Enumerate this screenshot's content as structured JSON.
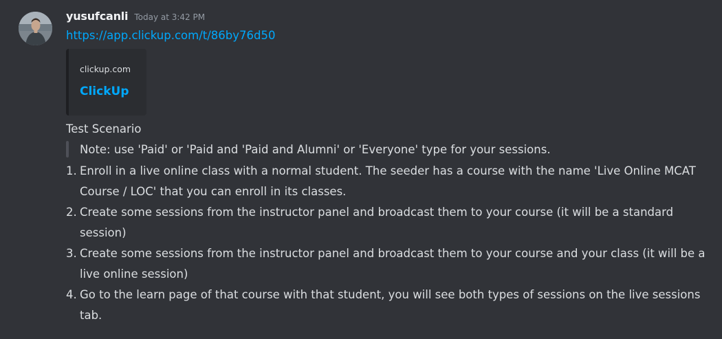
{
  "message": {
    "username": "yusufcanli",
    "timestamp": "Today at 3:42 PM",
    "link": "https://app.clickup.com/t/86by76d50",
    "embed": {
      "provider": "clickup.com",
      "title": "ClickUp"
    },
    "heading": "Test Scenario",
    "blockquote": "Note: use 'Paid' or 'Paid and 'Paid and Alumni' or 'Everyone' type for your sessions.",
    "list": [
      {
        "num": "1.",
        "text": "Enroll in a live online class with a normal student. The seeder has a course with the name 'Live Online MCAT Course / LOC' that you can enroll in its classes."
      },
      {
        "num": "2.",
        "text": "Create some sessions from the instructor panel and broadcast them to your course (it will be a standard session)"
      },
      {
        "num": "3.",
        "text": "Create some sessions from the instructor panel and broadcast them to your course and your class (it will be a live online session)"
      },
      {
        "num": "4.",
        "text": "Go to the learn page of that course with that student, you will see both types of sessions on the live sessions tab."
      }
    ]
  },
  "colors": {
    "background": "#313338",
    "link": "#00a8fc",
    "text": "#dbdee1",
    "muted": "#949ba4",
    "embed_bg": "#2b2d31"
  }
}
